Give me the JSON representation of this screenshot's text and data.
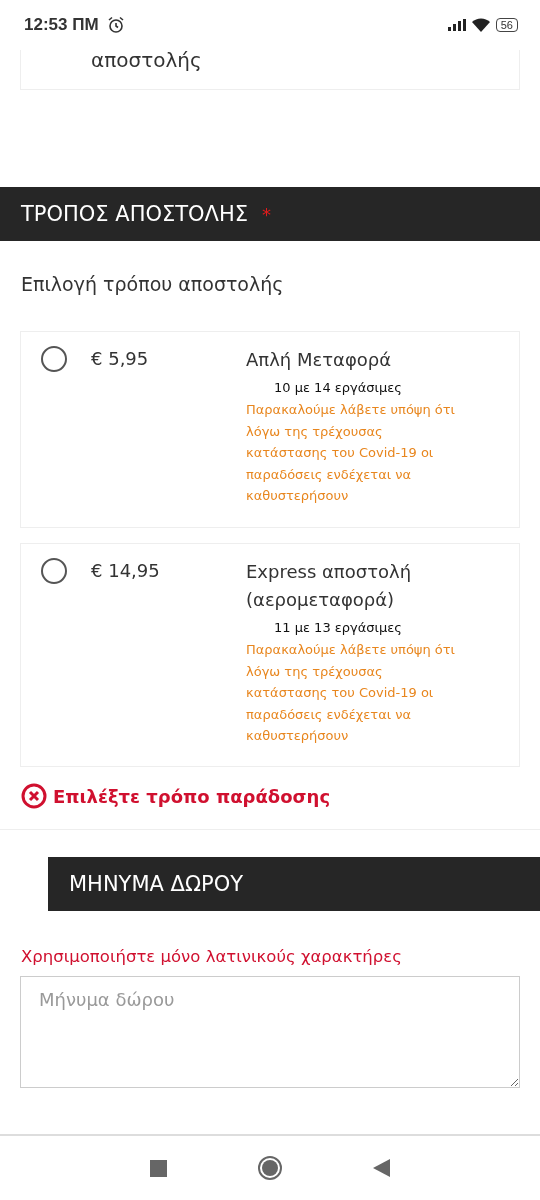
{
  "status_bar": {
    "time": "12:53 ΠΜ",
    "battery": "56"
  },
  "previous_card": {
    "text": "αποστολής"
  },
  "shipping": {
    "title": "ΤΡΟΠΟΣ ΑΠΟΣΤΟΛΗΣ",
    "required_mark": "*",
    "subtitle": "Επιλογή τρόπου αποστολής",
    "options": [
      {
        "price": "€ 5,95",
        "name": "Απλή Μεταφορά",
        "days": "10 με 14 εργάσιμες",
        "notice": "Παρακαλούμε λάβετε υπόψη ότι λόγω της τρέχουσας κατάστασης του Covid-19 οι παραδόσεις ενδέχεται να καθυστερήσουν",
        "selected": false
      },
      {
        "price": "€ 14,95",
        "name": "Express αποστολή (αερομεταφορά)",
        "days": "11 με 13 εργάσιμες",
        "notice": "Παρακαλούμε λάβετε υπόψη ότι λόγω της τρέχουσας κατάστασης του Covid-19 οι παραδόσεις ενδέχεται να καθυστερήσουν",
        "selected": false
      }
    ],
    "error": "Επιλέξτε τρόπο παράδοσης"
  },
  "gift_message": {
    "title": "ΜΗΝΥΜΑ ΔΩΡΟΥ",
    "hint": "Χρησιμοποιήστε μόνο λατινικούς χαρακτήρες",
    "placeholder": "Μήνυμα δώρου"
  }
}
